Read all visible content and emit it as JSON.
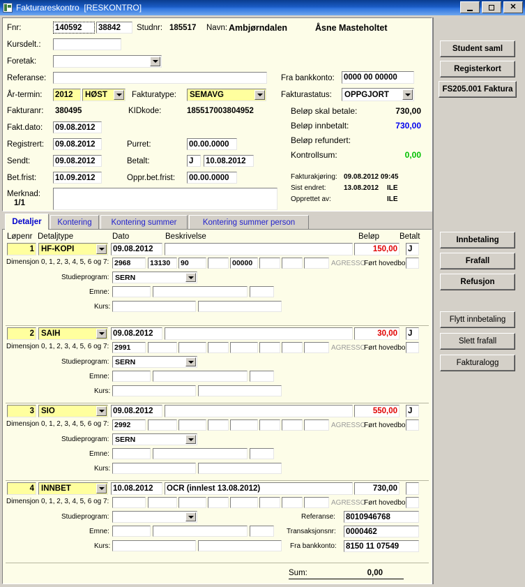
{
  "window": {
    "title": "Fakturareskontro  [RESKONTRO]",
    "icon": "app-icon",
    "minimize_label": "_",
    "maximize_label": "□",
    "close_label": "✕"
  },
  "form": {
    "fnr_label": "Fnr:",
    "fnr_part1": "140592",
    "fnr_part2": "38842",
    "studnr_label": "Studnr:",
    "studnr_value": "185517",
    "navn_label": "Navn:",
    "navn_last": "Ambjørndalen",
    "navn_first": "Åsne Masteholtet",
    "kursdelt_label": "Kursdelt.:",
    "kursdelt_value": "",
    "foretak_label": "Foretak:",
    "foretak_value": "",
    "referanse_label": "Referanse:",
    "referanse_value": "",
    "artermin_label": "År-termin:",
    "artermin_year": "2012",
    "artermin_season": "HØST",
    "fakturatype_label": "Fakturatype:",
    "fakturatype_value": "SEMAVG",
    "fakturanr_label": "Fakturanr:",
    "fakturanr_value": "380495",
    "kidkode_label": "KIDkode:",
    "kidkode_value": "185517003804952",
    "faktdato_label": "Fakt.dato:",
    "faktdato_value": "09.08.2012",
    "registrert_label": "Registrert:",
    "registrert_value": "09.08.2012",
    "purret_label": "Purret:",
    "purret_value": "00.00.0000",
    "sendt_label": "Sendt:",
    "sendt_value": "09.08.2012",
    "betalt_label": "Betalt:",
    "betalt_flag": "J",
    "betalt_date": "10.08.2012",
    "betfrist_label": "Bet.frist:",
    "betfrist_value": "10.09.2012",
    "opprbetfrist_label": "Oppr.bet.frist:",
    "opprbetfrist_value": "00.00.0000",
    "merknad_label": "Merknad:",
    "merknad_counter": "1/1",
    "merknad_value": "",
    "frabankkonto_label": "Fra bankkonto:",
    "frabankkonto_value": "0000 00 00000",
    "fakturastatus_label": "Fakturastatus:",
    "fakturastatus_value": "OPPGJORT",
    "belop_skal_betale_label": "Beløp skal betale:",
    "belop_skal_betale_value": "730,00",
    "belop_innbetalt_label": "Beløp innbetalt:",
    "belop_innbetalt_value": "730,00",
    "belop_refundert_label": "Beløp refundert:",
    "belop_refundert_value": "",
    "kontrollsum_label": "Kontrollsum:",
    "kontrollsum_value": "0,00",
    "fakturakjoring_label": "Fakturakjøring:",
    "fakturakjoring_value": "09.08.2012 09:45",
    "sist_endret_label": "Sist endret:",
    "sist_endret_value": "13.08.2012",
    "sist_endret_by": "ILE",
    "opprettet_av_label": "Opprettet av:",
    "opprettet_av_value": "ILE"
  },
  "colors": {
    "amount_negative": "#e00000",
    "amount_positive": "#0000ee",
    "kontrollsum": "#00c000",
    "tab_text": "#2222cc",
    "field_yellow": "#ffff9e",
    "panel_bg": "#d4d0c8",
    "form_bg": "#fdfde8"
  },
  "tabs": [
    {
      "label": "Detaljer",
      "active": true
    },
    {
      "label": "Kontering",
      "active": false
    },
    {
      "label": "Kontering summer",
      "active": false
    },
    {
      "label": "Kontering summer person",
      "active": false
    }
  ],
  "details": {
    "headers": {
      "lopenr": "Løpenr",
      "detaljtype": "Detaljtype",
      "dato": "Dato",
      "beskrivelse": "Beskrivelse",
      "belop": "Beløp",
      "betalt": "Betalt"
    },
    "sub_labels": {
      "dimensjon": "Dimensjon 0, 1, 2, 3, 4, 5, 6 og 7:",
      "agresso": "AGRESSO",
      "fort_hovedbok": "Ført hovedbok:",
      "studieprogram": "Studieprogram:",
      "emne": "Emne:",
      "kurs": "Kurs:",
      "referanse": "Referanse:",
      "transaksjonsnr": "Transaksjonsnr:",
      "fra_bankkonto": "Fra bankkonto:"
    },
    "rows": [
      {
        "lopenr": "1",
        "detaljtype": "HF-KOPI",
        "dato": "09.08.2012",
        "beskrivelse": "",
        "belop": "150,00",
        "belop_color": "#e00000",
        "betalt": "J",
        "dimensjoner": [
          "2968",
          "13130",
          "90",
          "",
          "00000",
          "",
          "",
          ""
        ],
        "fort_hovedbok": "",
        "studieprogram": "SERN",
        "emne1": "",
        "emne2": "",
        "emne3": "",
        "kurs1": "",
        "kurs2": "",
        "has_payment_fields": false
      },
      {
        "lopenr": "2",
        "detaljtype": "SAIH",
        "dato": "09.08.2012",
        "beskrivelse": "",
        "belop": "30,00",
        "belop_color": "#e00000",
        "betalt": "J",
        "dimensjoner": [
          "2991",
          "",
          "",
          "",
          "",
          "",
          "",
          ""
        ],
        "fort_hovedbok": "",
        "studieprogram": "SERN",
        "emne1": "",
        "emne2": "",
        "emne3": "",
        "kurs1": "",
        "kurs2": "",
        "has_payment_fields": false
      },
      {
        "lopenr": "3",
        "detaljtype": "SIO",
        "dato": "09.08.2012",
        "beskrivelse": "",
        "belop": "550,00",
        "belop_color": "#e00000",
        "betalt": "J",
        "dimensjoner": [
          "2992",
          "",
          "",
          "",
          "",
          "",
          "",
          ""
        ],
        "fort_hovedbok": "",
        "studieprogram": "SERN",
        "emne1": "",
        "emne2": "",
        "emne3": "",
        "kurs1": "",
        "kurs2": "",
        "has_payment_fields": false
      },
      {
        "lopenr": "4",
        "detaljtype": "INNBET",
        "dato": "10.08.2012",
        "beskrivelse": "OCR (innlest 13.08.2012)",
        "belop": "730,00",
        "belop_color": "#000000",
        "betalt": "",
        "dimensjoner": [
          "",
          "",
          "",
          "",
          "",
          "",
          "",
          ""
        ],
        "fort_hovedbok": "",
        "studieprogram": "",
        "emne1": "",
        "emne2": "",
        "emne3": "",
        "kurs1": "",
        "kurs2": "",
        "has_payment_fields": true,
        "referanse": "8010946768",
        "transaksjonsnr": "0000462",
        "fra_bankkonto": "8150 11 07549"
      }
    ],
    "sum_label": "Sum:",
    "sum_value": "0,00"
  },
  "side_buttons_top": [
    {
      "label": "Student saml"
    },
    {
      "label": "Registerkort"
    },
    {
      "label": "FS205.001 Faktura"
    }
  ],
  "side_buttons_detail": [
    {
      "label": "Innbetaling",
      "bold": true
    },
    {
      "label": "Frafall",
      "bold": true
    },
    {
      "label": "Refusjon",
      "bold": true
    }
  ],
  "side_buttons_detail2": [
    {
      "label": "Flytt innbetaling",
      "bold": false
    },
    {
      "label": "Slett frafall",
      "bold": false
    },
    {
      "label": "Fakturalogg",
      "bold": false
    }
  ]
}
